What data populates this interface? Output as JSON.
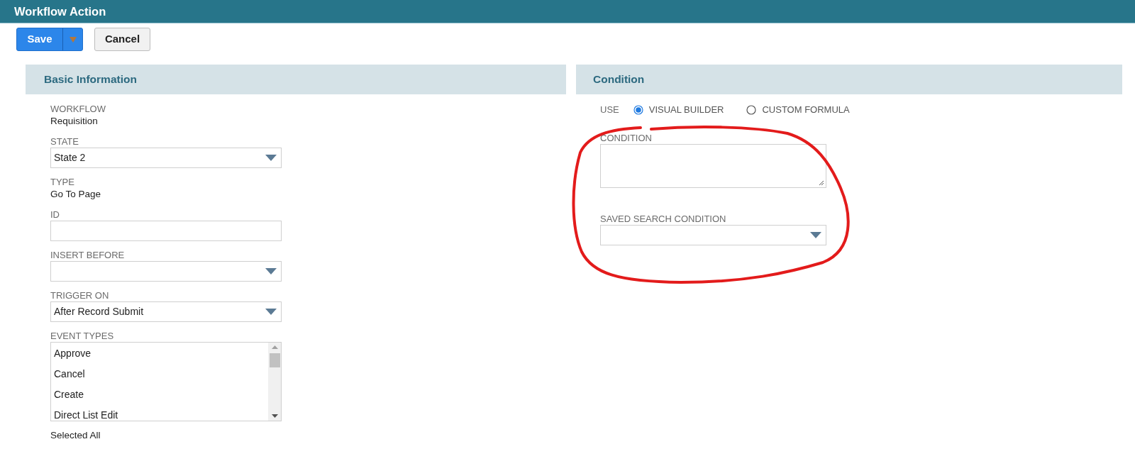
{
  "window": {
    "title": "Workflow Action"
  },
  "toolbar": {
    "save": {
      "label": "Save"
    },
    "cancel": {
      "label": "Cancel"
    }
  },
  "basic_information": {
    "title": "Basic Information",
    "fields": [
      {
        "kind": "text",
        "label": "WORKFLOW",
        "value": "Requisition"
      },
      {
        "kind": "select",
        "label": "STATE",
        "value": "State 2"
      },
      {
        "kind": "text",
        "label": "TYPE",
        "value": "Go To Page"
      },
      {
        "kind": "input",
        "label": "ID"
      },
      {
        "kind": "select",
        "label": "INSERT BEFORE"
      },
      {
        "kind": "select",
        "label": "TRIGGER ON",
        "value": "After Record Submit"
      },
      {
        "kind": "listbox",
        "label": "EVENT TYPES",
        "items": [
          "Approve",
          "Cancel",
          "Create",
          "Direct List Edit"
        ],
        "footer": "Selected All"
      }
    ]
  },
  "condition": {
    "title": "Condition",
    "use_label": "USE",
    "use_options": [
      {
        "label": "VISUAL BUILDER",
        "selected": true
      },
      {
        "label": "CUSTOM FORMULA",
        "selected": false
      }
    ],
    "fields": [
      {
        "kind": "textarea",
        "label": "CONDITION"
      },
      {
        "kind": "select",
        "label": "SAVED SEARCH CONDITION"
      }
    ]
  }
}
